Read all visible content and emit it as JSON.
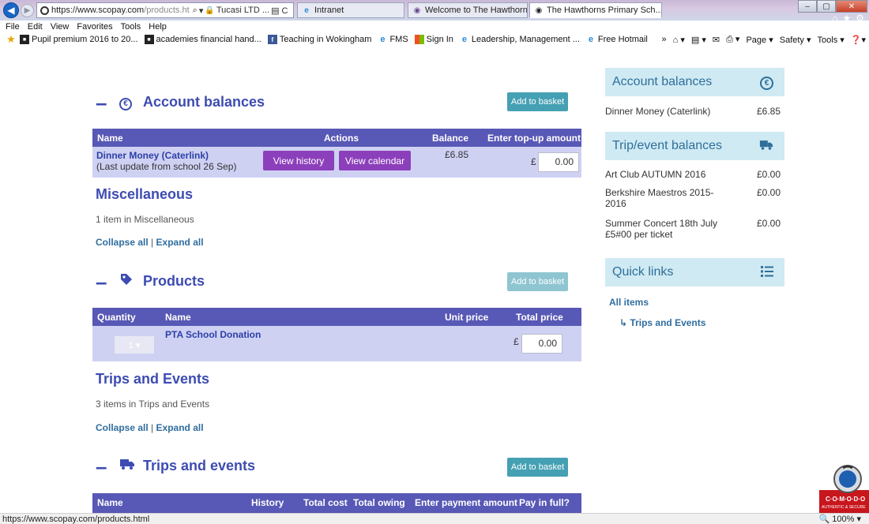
{
  "browser": {
    "address": {
      "scheme": "https://",
      "host": "www.scopay.com",
      "rest": "/products.ht"
    },
    "address_tools": {
      "search": "⌕",
      "dropdown": "▾",
      "lock": "🔒",
      "cert": "Tucasi LTD ...",
      "extra": "▤ C"
    },
    "tabs": [
      {
        "label": "Intranet"
      },
      {
        "label": "Welcome to The Hawthorns Pri..."
      },
      {
        "label": "The Hawthorns Primary Sch...",
        "close": "✕"
      }
    ],
    "window_controls": {
      "minimize": "–",
      "maximize": "▢",
      "close": "✕"
    }
  },
  "menu": [
    "File",
    "Edit",
    "View",
    "Favorites",
    "Tools",
    "Help"
  ],
  "favorites": [
    {
      "label": "Pupil premium 2016 to 20...",
      "icon": "dark"
    },
    {
      "label": "academies financial hand...",
      "icon": "dark"
    },
    {
      "label": "Teaching in Wokingham",
      "icon": "fb"
    },
    {
      "label": "FMS",
      "icon": "ie"
    },
    {
      "label": "Sign In",
      "icon": "ms"
    },
    {
      "label": "Leadership, Management ...",
      "icon": "ie"
    },
    {
      "label": "Free Hotmail",
      "icon": "ie"
    }
  ],
  "command_bar": {
    "chevrons": "»",
    "page": "Page ▾",
    "safety": "Safety ▾",
    "tools": "Tools ▾"
  },
  "account_section": {
    "title": "Account balances",
    "basket_label": "Add to basket",
    "headers": {
      "name": "Name",
      "actions": "Actions",
      "balance": "Balance",
      "topup": "Enter top-up amount"
    },
    "row": {
      "name": "Dinner Money (Caterlink)",
      "sub": "(Last update from school 26 Sep)",
      "view_history": "View history",
      "view_calendar": "View calendar",
      "balance": "£6.85",
      "currency": "£",
      "amount": "0.00"
    }
  },
  "misc_section": {
    "title": "Miscellaneous",
    "count": "1 item in Miscellaneous",
    "collapse": "Collapse all",
    "sep": "|",
    "expand": "Expand all"
  },
  "products_section": {
    "title": "Products",
    "basket_label": "Add to basket",
    "headers": {
      "quantity": "Quantity",
      "name": "Name",
      "unit_price": "Unit price",
      "total_price": "Total price"
    },
    "row": {
      "qty": "1 ▾",
      "name": "PTA School Donation",
      "currency": "£",
      "amount": "0.00"
    }
  },
  "trips_info": {
    "title": "Trips and Events",
    "count": "3 items in Trips and Events",
    "collapse": "Collapse all",
    "sep": "|",
    "expand": "Expand all"
  },
  "trips_section": {
    "title": "Trips and events",
    "basket_label": "Add to basket",
    "headers": {
      "name": "Name",
      "history": "History",
      "total_cost": "Total cost",
      "total_owing": "Total owing",
      "payment": "Enter payment amount",
      "pay_full": "Pay in full?"
    }
  },
  "sidebar": {
    "account_balances": {
      "title": "Account balances",
      "items": [
        {
          "name": "Dinner Money (Caterlink)",
          "value": "£6.85"
        }
      ]
    },
    "trip_balances": {
      "title": "Trip/event balances",
      "items": [
        {
          "name": "Art Club AUTUMN 2016",
          "value": "£0.00"
        },
        {
          "name": "Berkshire Maestros 2015-2016",
          "value": "£0.00"
        },
        {
          "name": "Summer Concert 18th July £5#00 per ticket",
          "value": "£0.00"
        }
      ]
    },
    "quick_links": {
      "title": "Quick links",
      "all_items": "All items",
      "trips": "Trips and Events"
    }
  },
  "comodo": {
    "brand": "C·O·M·O·D·O",
    "tagline": "AUTHENTIC & SECURE"
  },
  "status": {
    "url": "https://www.scopay.com/products.html",
    "zoom": "100%"
  },
  "colors": {
    "section_heading": "#3d4cb2",
    "table_header": "#5858b6",
    "row_bg": "#cfd1f3",
    "basket_btn": "#45a0b3",
    "action_btn": "#8c3fbb",
    "sidebar_head": "#cfeaf3"
  }
}
